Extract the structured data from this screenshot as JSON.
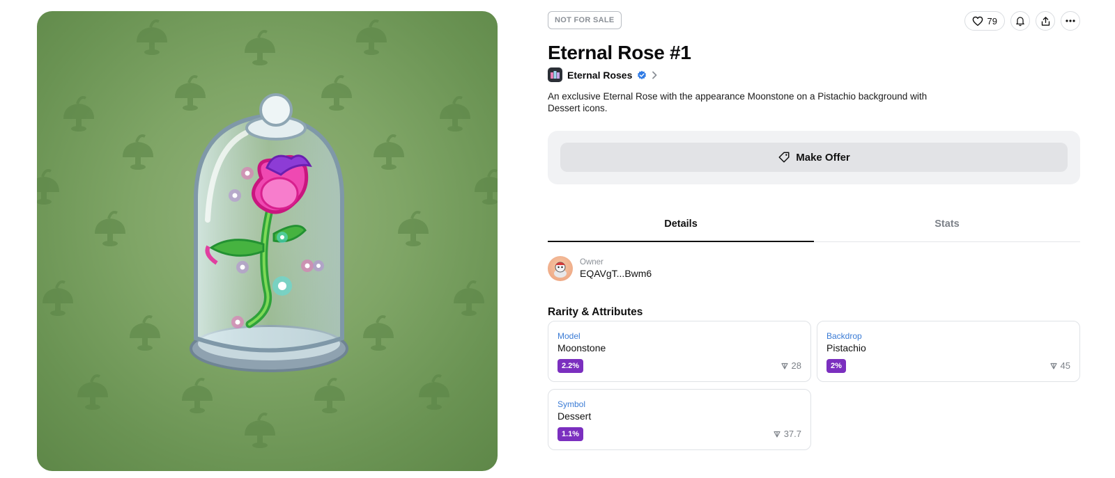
{
  "colors": {
    "accent_purple": "#7b2fbf",
    "link_blue": "#3a7bd5",
    "background_art": "#7fa566"
  },
  "artwork": {
    "icon": "rose-in-glass-dome"
  },
  "status_badge": "NOT FOR SALE",
  "likes": "79",
  "title": "Eternal Rose #1",
  "collection": {
    "name": "Eternal Roses",
    "verified_icon": "verified-badge-icon"
  },
  "description": "An exclusive Eternal Rose with the appearance Moonstone on a Pistachio background with Dessert icons.",
  "make_offer_label": "Make Offer",
  "tabs": [
    {
      "label": "Details",
      "active": true
    },
    {
      "label": "Stats",
      "active": false
    }
  ],
  "owner": {
    "label": "Owner",
    "address": "EQAVgT...Bwm6"
  },
  "rarity_section_title": "Rarity & Attributes",
  "attributes": [
    {
      "type": "Model",
      "value": "Moonstone",
      "rarity": "2.2%",
      "price": "28"
    },
    {
      "type": "Backdrop",
      "value": "Pistachio",
      "rarity": "2%",
      "price": "45"
    },
    {
      "type": "Symbol",
      "value": "Dessert",
      "rarity": "1.1%",
      "price": "37.7"
    }
  ]
}
